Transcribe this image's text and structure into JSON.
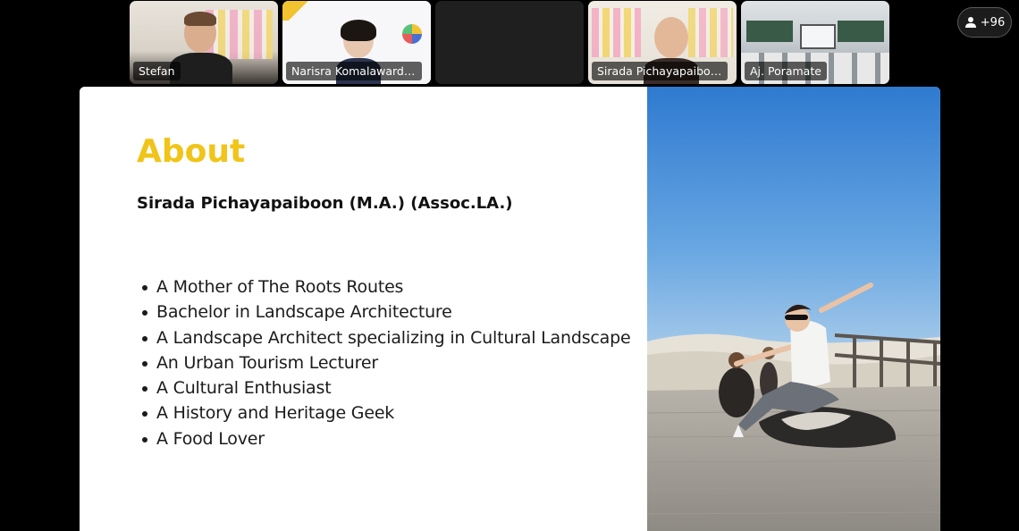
{
  "participants": [
    {
      "name": "Stefan"
    },
    {
      "name": "Narisra Komalawardh..."
    },
    {
      "name": ""
    },
    {
      "name": "Sirada Pichayapaiboon"
    },
    {
      "name": "Aj. Poramate"
    }
  ],
  "overflow": {
    "count_label": "+96",
    "icon": "person-icon"
  },
  "slide": {
    "title": "About",
    "subtitle": "Sirada Pichayapaiboon (M.A.) (Assoc.LA.)",
    "bullets": [
      "A Mother of The Roots Routes",
      "Bachelor in Landscape Architecture",
      "A Landscape Architect specializing in Cultural Landscape",
      "An Urban Tourism Lecturer",
      "A Cultural Enthusiast",
      "A History and Heritage Geek",
      "A Food Lover"
    ],
    "title_color": "#f0c419",
    "photo": "woman-dancing-on-boardwalk-photo"
  }
}
